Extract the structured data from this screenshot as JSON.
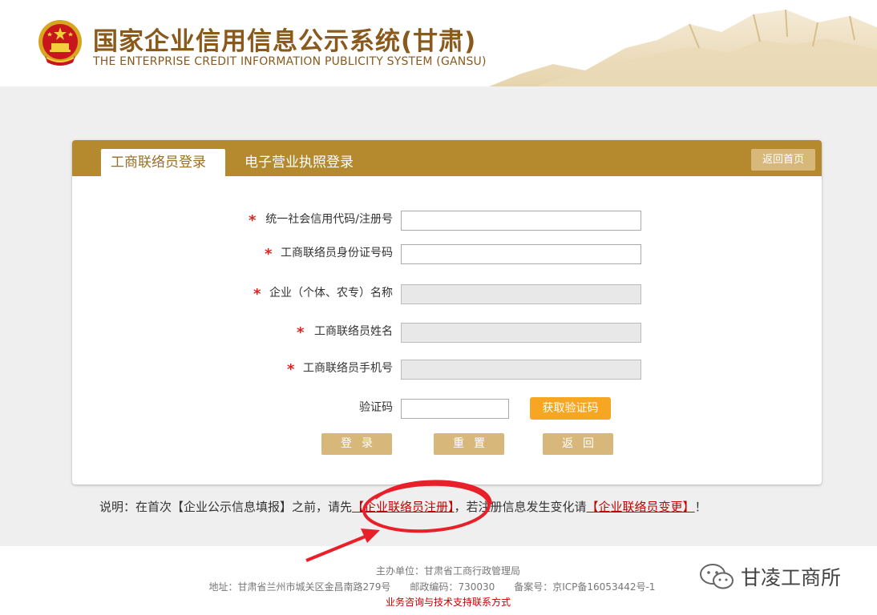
{
  "header": {
    "title_cn": "国家企业信用信息公示系统(甘肃)",
    "title_en": "THE ENTERPRISE CREDIT INFORMATION PUBLICITY SYSTEM (GANSU)"
  },
  "tabs": [
    {
      "label": "工商联络员登录",
      "active": true
    },
    {
      "label": "电子营业执照登录",
      "active": false
    }
  ],
  "back_home_label": "返回首页",
  "form": {
    "fields": [
      {
        "label": "统一社会信用代码/注册号",
        "required": true,
        "value": "",
        "disabled": false
      },
      {
        "label": "工商联络员身份证号码",
        "required": true,
        "value": "",
        "disabled": false
      },
      {
        "label": "企业（个体、农专）名称",
        "required": true,
        "value": "",
        "disabled": true
      },
      {
        "label": "工商联络员姓名",
        "required": true,
        "value": "",
        "disabled": true
      },
      {
        "label": "工商联络员手机号",
        "required": true,
        "value": "",
        "disabled": true
      }
    ],
    "captcha_label": "验证码",
    "captcha_value": "",
    "get_code_label": "获取验证码",
    "required_mark": "*"
  },
  "actions": {
    "login": "登录",
    "reset": "重置",
    "back": "返回"
  },
  "note": {
    "prefix": "说明：在首次【企业公示信息填报】之前，请先",
    "register_link": "【企业联络员注册】",
    "middle": "，若注册信息发生变化请",
    "change_link": "【企业联络员变更】",
    "suffix": "！"
  },
  "footer": {
    "host": "主办单位：甘肃省工商行政管理局",
    "address": "地址：甘肃省兰州市城关区金昌南路279号　　邮政编码：730030　　备案号：京ICP备16053442号-1",
    "support": "业务咨询与技术支持联系方式"
  },
  "watermark": "甘凌工商所",
  "colors": {
    "brand_gold": "#b58a2e",
    "button_tan": "#d8b87a",
    "captcha_orange": "#f6a623",
    "link_red": "#c40000",
    "annotation_red": "#e8202a"
  },
  "icons": [
    "national-emblem-icon",
    "wechat-icon"
  ]
}
